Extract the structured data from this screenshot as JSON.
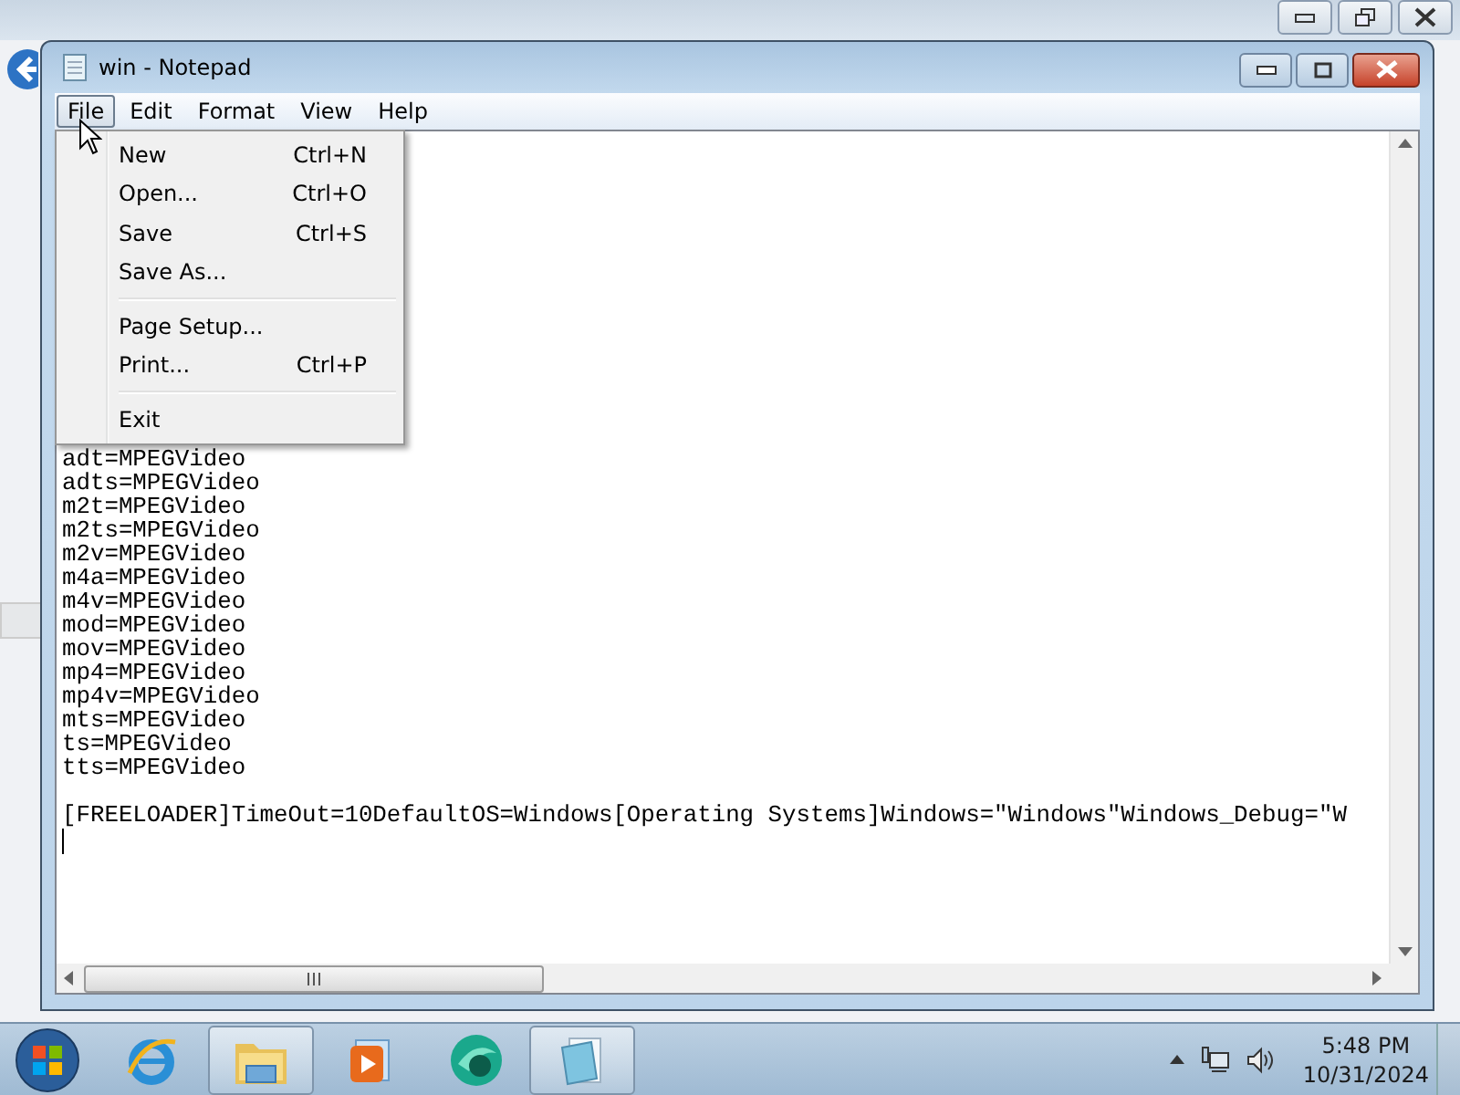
{
  "notepad": {
    "title": "win - Notepad",
    "menu_bar": [
      {
        "label": "File",
        "selected": true
      },
      {
        "label": "Edit",
        "selected": false
      },
      {
        "label": "Format",
        "selected": false
      },
      {
        "label": "View",
        "selected": false
      },
      {
        "label": "Help",
        "selected": false
      }
    ],
    "file_menu": [
      {
        "kind": "item",
        "label": "New",
        "shortcut": "Ctrl+N"
      },
      {
        "kind": "item",
        "label": "Open...",
        "shortcut": "Ctrl+O"
      },
      {
        "kind": "item",
        "label": "Save",
        "shortcut": "Ctrl+S"
      },
      {
        "kind": "item",
        "label": "Save As..."
      },
      {
        "kind": "separator"
      },
      {
        "kind": "item",
        "label": "Page Setup..."
      },
      {
        "kind": "item",
        "label": "Print...",
        "shortcut": "Ctrl+P"
      },
      {
        "kind": "separator"
      },
      {
        "kind": "item",
        "label": "Exit"
      }
    ],
    "text_blocks": [
      [
        "adt=MPEGVideo",
        "adts=MPEGVideo",
        "m2t=MPEGVideo",
        "m2ts=MPEGVideo",
        "m2v=MPEGVideo",
        "m4a=MPEGVideo",
        "m4v=MPEGVideo",
        "mod=MPEGVideo",
        "mov=MPEGVideo",
        "mp4=MPEGVideo",
        "mp4v=MPEGVideo",
        "mts=MPEGVideo",
        "ts=MPEGVideo",
        "tts=MPEGVideo"
      ],
      [
        "[FREELOADER]TimeOut=10DefaultOS=Windows[Operating Systems]Windows=\"Windows\"Windows_Debug=\"W"
      ]
    ]
  },
  "taskbar": {
    "apps": [
      {
        "kind": "browser",
        "running": false
      },
      {
        "kind": "folder",
        "running": true
      },
      {
        "kind": "media",
        "running": false
      },
      {
        "kind": "green-app",
        "running": false
      },
      {
        "kind": "notepad",
        "running": true
      }
    ],
    "clock": {
      "time": "5:48 PM",
      "date": "10/31/2024"
    }
  }
}
